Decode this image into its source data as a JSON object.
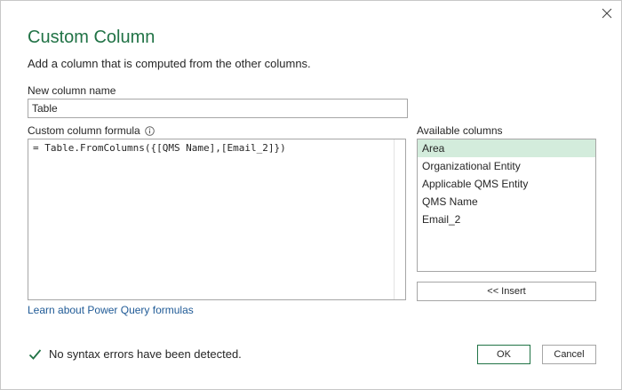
{
  "dialog": {
    "title": "Custom Column",
    "subtitle": "Add a column that is computed from the other columns."
  },
  "name_field": {
    "label": "New column name",
    "value": "Table"
  },
  "formula": {
    "label": "Custom column formula",
    "value": "= Table.FromColumns({[QMS Name],[Email_2]})",
    "help_link": "Learn about Power Query formulas"
  },
  "available_columns": {
    "label": "Available columns",
    "items": [
      {
        "label": "Area",
        "selected": true
      },
      {
        "label": "Organizational Entity"
      },
      {
        "label": "Applicable QMS Entity"
      },
      {
        "label": "QMS Name"
      },
      {
        "label": "Email_2"
      }
    ],
    "insert_label": "<< Insert"
  },
  "status": {
    "text": "No syntax errors have been detected.",
    "icon": "checkmark-icon",
    "color": "#217346"
  },
  "buttons": {
    "ok": "OK",
    "cancel": "Cancel"
  },
  "colors": {
    "accent": "#217346",
    "selection": "#d3ecdc",
    "link": "#1f5a96"
  }
}
